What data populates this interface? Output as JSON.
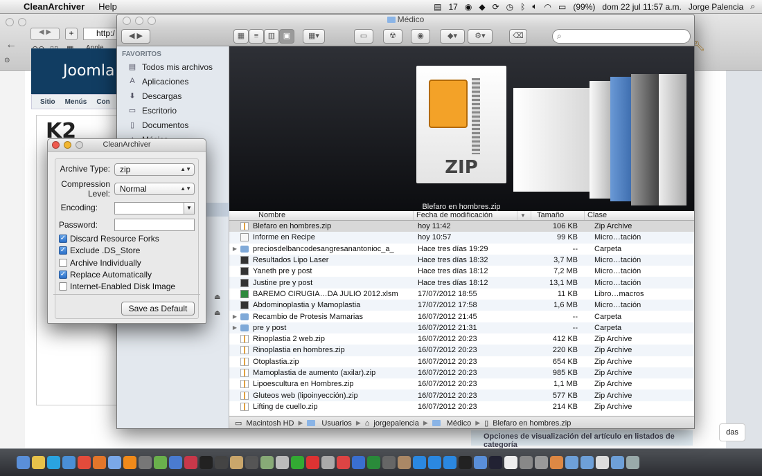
{
  "menubar": {
    "app_name": "CleanArchiver",
    "menus": [
      "Help"
    ],
    "battery": "(99%)",
    "datetime": "dom 22 jul  11:57 a.m.",
    "user": "Jorge Palencia",
    "status_number": "17"
  },
  "browser": {
    "address": "http:/",
    "bookmark_apple": "Apple",
    "joomla_logo": "Joomla",
    "nav_items": [
      "Sitio",
      "Menús",
      "Con"
    ],
    "k2_logo": "K2",
    "bottom_note": "Opciones de visualización del artículo en listados de categoría",
    "right_button": "das"
  },
  "finder": {
    "title": "Médico",
    "sidebar": {
      "heading": "FAVORITOS",
      "items": [
        "Todos mis archivos",
        "Aplicaciones",
        "Descargas",
        "Escritorio",
        "Documentos",
        "Música"
      ]
    },
    "coverflow": {
      "zip_label": "ZIP",
      "caption": "Blefaro en hombres.zip"
    },
    "columns": {
      "name": "Nombre",
      "date": "Fecha de modificación",
      "size": "Tamaño",
      "kind": "Clase"
    },
    "files": [
      {
        "name": "Blefaro en hombres.zip",
        "date": "hoy 11:42",
        "size": "106 KB",
        "kind": "Zip Archive",
        "icon": "zip",
        "folder": false
      },
      {
        "name": "Informe en Recipe",
        "date": "hoy 10:57",
        "size": "99 KB",
        "kind": "Micro…tación",
        "icon": "doc",
        "folder": false
      },
      {
        "name": "preciosdelbancodesangresanantonioc_a_",
        "date": "Hace tres días 19:29",
        "size": "--",
        "kind": "Carpeta",
        "icon": "folder",
        "folder": true
      },
      {
        "name": "Resultados Lipo Laser",
        "date": "Hace tres días 18:32",
        "size": "3,7 MB",
        "kind": "Micro…tación",
        "icon": "img",
        "folder": false
      },
      {
        "name": "Yaneth pre y post",
        "date": "Hace tres días 18:12",
        "size": "7,2 MB",
        "kind": "Micro…tación",
        "icon": "img",
        "folder": false
      },
      {
        "name": "Justine pre y post",
        "date": "Hace tres días 18:12",
        "size": "13,1 MB",
        "kind": "Micro…tación",
        "icon": "img",
        "folder": false
      },
      {
        "name": "BAREMO  CIRUGIA…DA JULIO 2012.xlsm",
        "date": "17/07/2012 18:55",
        "size": "11 KB",
        "kind": "Libro…macros",
        "icon": "xls",
        "folder": false
      },
      {
        "name": "Abdominoplastia y Mamoplastia",
        "date": "17/07/2012 17:58",
        "size": "1,6 MB",
        "kind": "Micro…tación",
        "icon": "img",
        "folder": false
      },
      {
        "name": "Recambio de Protesis Mamarias",
        "date": "16/07/2012 21:45",
        "size": "--",
        "kind": "Carpeta",
        "icon": "folder",
        "folder": true
      },
      {
        "name": "pre y post",
        "date": "16/07/2012 21:31",
        "size": "--",
        "kind": "Carpeta",
        "icon": "folder",
        "folder": true
      },
      {
        "name": "Rinoplastia 2 web.zip",
        "date": "16/07/2012 20:23",
        "size": "412 KB",
        "kind": "Zip Archive",
        "icon": "zip",
        "folder": false
      },
      {
        "name": "Rinoplastia en hombres.zip",
        "date": "16/07/2012 20:23",
        "size": "220 KB",
        "kind": "Zip Archive",
        "icon": "zip",
        "folder": false
      },
      {
        "name": "Otoplastia.zip",
        "date": "16/07/2012 20:23",
        "size": "654 KB",
        "kind": "Zip Archive",
        "icon": "zip",
        "folder": false
      },
      {
        "name": "Mamoplastia de aumento (axilar).zip",
        "date": "16/07/2012 20:23",
        "size": "985 KB",
        "kind": "Zip Archive",
        "icon": "zip",
        "folder": false
      },
      {
        "name": "Lipoescultura en Hombres.zip",
        "date": "16/07/2012 20:23",
        "size": "1,1 MB",
        "kind": "Zip Archive",
        "icon": "zip",
        "folder": false
      },
      {
        "name": "Gluteos web (lipoinyección).zip",
        "date": "16/07/2012 20:23",
        "size": "577 KB",
        "kind": "Zip Archive",
        "icon": "zip",
        "folder": false
      },
      {
        "name": "Lifting de cuello.zip",
        "date": "16/07/2012 20:23",
        "size": "214 KB",
        "kind": "Zip Archive",
        "icon": "zip",
        "folder": false
      }
    ],
    "path": [
      "Macintosh HD",
      "Usuarios",
      "jorgepalencia",
      "Médico",
      "Blefaro en hombres.zip"
    ]
  },
  "cleanarchiver": {
    "title": "CleanArchiver",
    "archive_type_label": "Archive Type:",
    "archive_type_value": "zip",
    "compression_label_1": "Compression",
    "compression_label_2": "Level:",
    "compression_value": "Normal",
    "encoding_label": "Encoding:",
    "encoding_value": "",
    "password_label": "Password:",
    "password_value": "",
    "options": [
      {
        "label": "Discard Resource Forks",
        "checked": true
      },
      {
        "label": "Exclude .DS_Store",
        "checked": true
      },
      {
        "label": "Archive Individually",
        "checked": false
      },
      {
        "label": "Replace Automatically",
        "checked": true
      },
      {
        "label": "Internet-Enabled Disk Image",
        "checked": false
      }
    ],
    "save_default": "Save as Default"
  },
  "colors": {
    "close": "#ee5b4f",
    "minimize": "#f2b631",
    "zoom_inactive": "#d5d5d5",
    "selection": "#d8d8d8",
    "joomla_blue": "#113d62"
  },
  "dock_icons": [
    "finder-icon",
    "stickies-icon",
    "skype-icon",
    "safari-icon",
    "chrome-icon",
    "firefox-icon",
    "messages-icon",
    "vlc-icon",
    "facetime-icon",
    "preview-icon",
    "itunes-icon",
    "photo-booth-icon",
    "blackberry-icon",
    "photo-icon",
    "script-editor-icon",
    "aperture-icon",
    "directory-utility-icon",
    "imovie-icon",
    "activity-monitor-icon",
    "acrobat-icon",
    "utility-icon",
    "powerpoint-icon",
    "word-icon",
    "excel-icon",
    "calculator-icon",
    "contacts-icon",
    "dropbox-icon",
    "dropbox-icon",
    "dropbox-icon",
    "terminal-icon",
    "downloads-icon",
    "steam-icon",
    "ical-icon",
    "system-preferences-icon",
    "screenshot-icon",
    "cleanarchiver-icon",
    "folder-icon",
    "folder-icon",
    "document-icon",
    "folder-icon",
    "trash-icon"
  ]
}
